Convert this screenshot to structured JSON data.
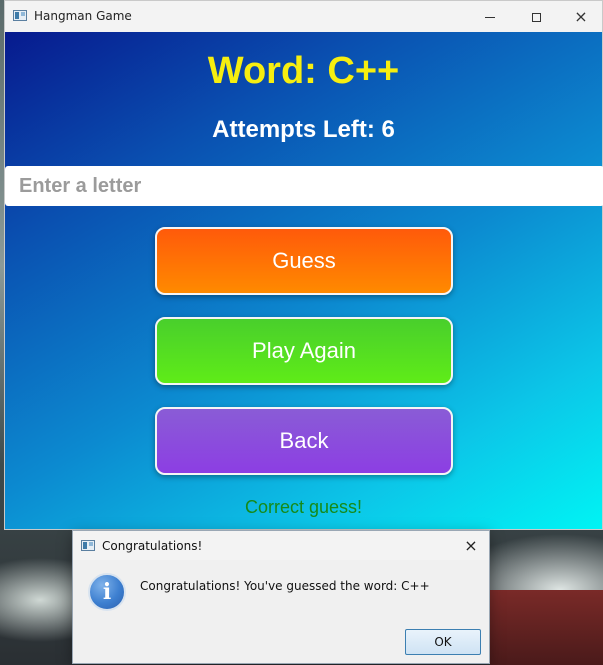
{
  "main_window": {
    "title": "Hangman Game",
    "controls": {
      "minimize": "minimize-icon",
      "maximize": "maximize-icon",
      "close": "×"
    },
    "word_label": "Word: C++",
    "attempts_label": "Attempts Left: 6",
    "input": {
      "placeholder": "Enter a letter",
      "value": ""
    },
    "buttons": {
      "guess": "Guess",
      "play_again": "Play Again",
      "back": "Back"
    },
    "status_text": "Correct guess!",
    "colors": {
      "word": "#f6ee10",
      "guess_button": "#ff6a00",
      "play_again_button": "#52dc22",
      "back_button": "#8a4be0",
      "status": "#168a18"
    }
  },
  "dialog": {
    "title": "Congratulations!",
    "close": "×",
    "icon": "info-icon",
    "icon_glyph": "i",
    "message": "Congratulations! You've guessed the word: C++",
    "ok_label": "OK"
  }
}
